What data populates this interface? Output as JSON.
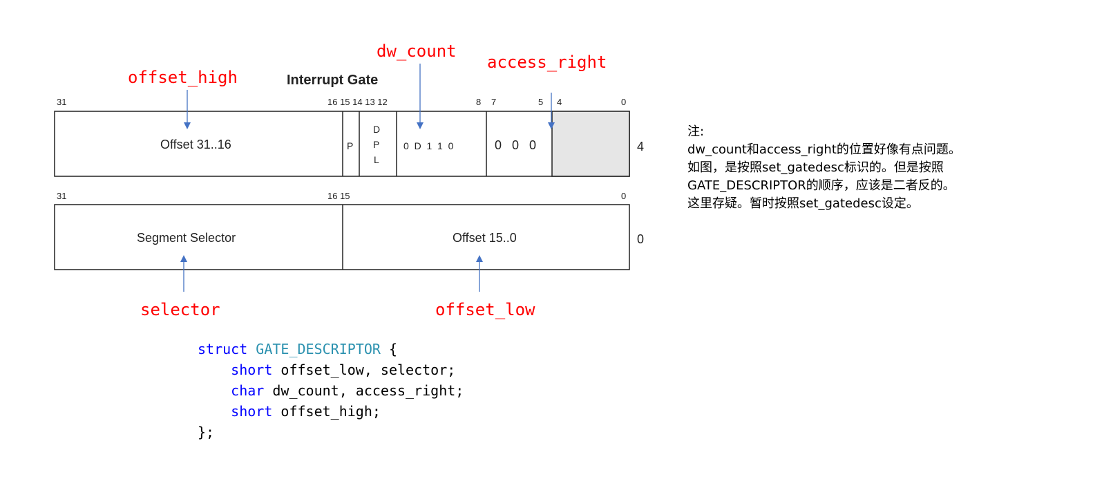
{
  "diagram": {
    "title": "Interrupt Gate",
    "top_row": {
      "bit_numbers": [
        "31",
        "16 15 14 13 12",
        "8",
        "7",
        "5",
        "4",
        "0"
      ],
      "fields": {
        "offset_high": "Offset 31..16",
        "p": "P",
        "dpl": [
          "D",
          "P",
          "L"
        ],
        "type_bits": "0  D  1  1  0",
        "zero_bits": "0   0   0"
      },
      "row_index": "4"
    },
    "bottom_row": {
      "bit_numbers": [
        "31",
        "16 15",
        "0"
      ],
      "fields": {
        "segment_selector": "Segment Selector",
        "offset_low": "Offset 15..0"
      },
      "row_index": "0"
    },
    "labels": {
      "offset_high": "offset_high",
      "dw_count": "dw_count",
      "access_right": "access_right",
      "selector": "selector",
      "offset_low": "offset_low"
    }
  },
  "code": {
    "line1_kw": "struct",
    "line1_type": "GATE_DESCRIPTOR",
    "line1_rest": " {",
    "line2_kw": "short",
    "line2_rest": " offset_low, selector;",
    "line3_kw": "char",
    "line3_rest": " dw_count, access_right;",
    "line4_kw": "short",
    "line4_rest": " offset_high;",
    "line5": "};"
  },
  "note": {
    "lines": [
      "注:",
      "dw_count和access_right的位置好像有点问题。",
      "如图，是按照set_gatedesc标识的。但是按照",
      "GATE_DESCRIPTOR的顺序，应该是二者反的。",
      "这里存疑。暂时按照set_gatedesc设定。"
    ]
  },
  "colors": {
    "label_red": "#ff0000",
    "arrow_blue": "#4472c4",
    "keyword_blue": "#0000ff",
    "type_teal": "#2b91af",
    "reserved_gray": "#e6e6e6"
  }
}
